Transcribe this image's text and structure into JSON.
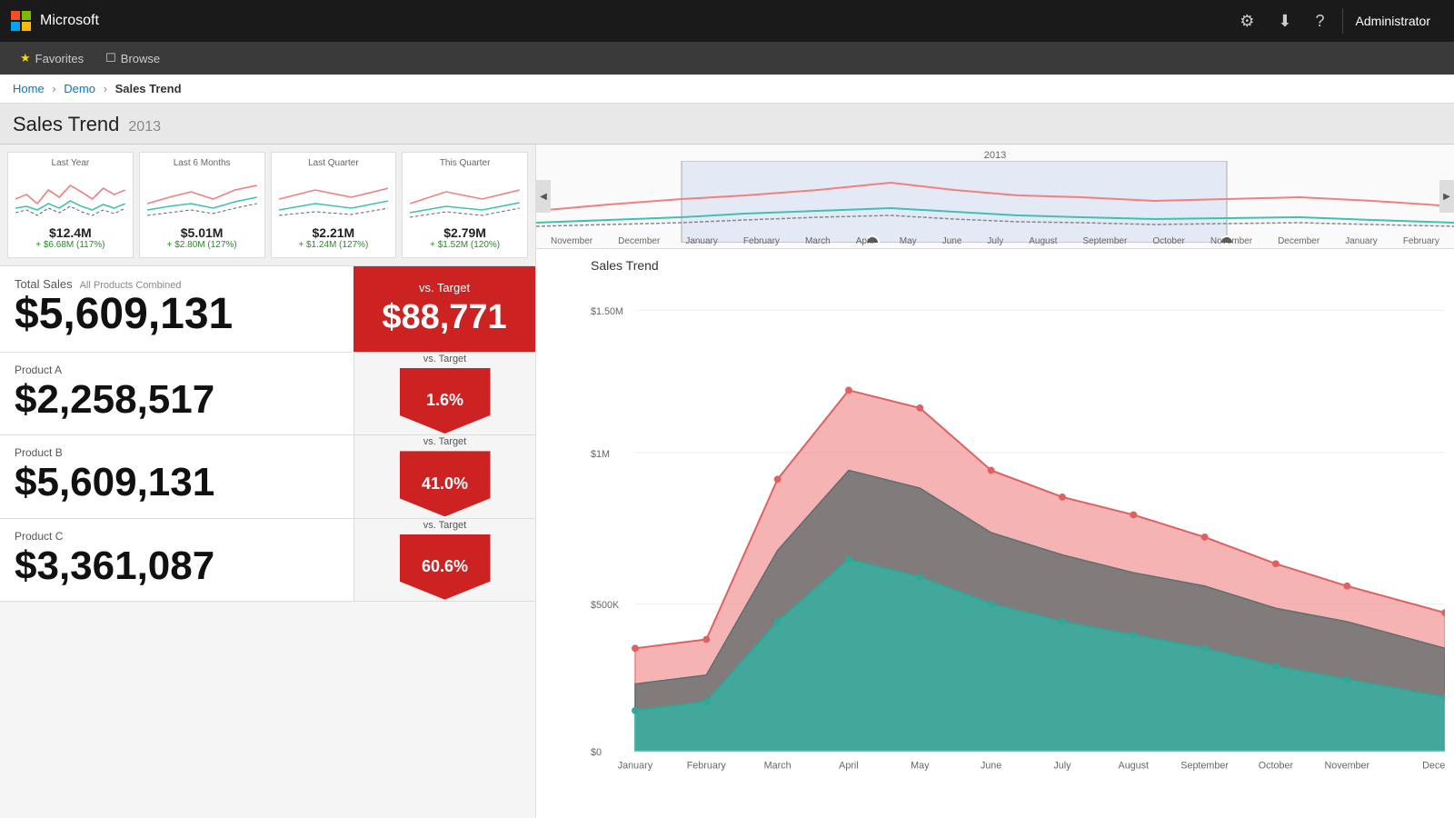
{
  "topbar": {
    "brand": "Microsoft",
    "settings_label": "⚙",
    "download_label": "⬇",
    "help_label": "?",
    "user": "Administrator"
  },
  "secondbar": {
    "favorites_label": "Favorites",
    "browse_label": "Browse"
  },
  "breadcrumb": {
    "home": "Home",
    "demo": "Demo",
    "current": "Sales Trend"
  },
  "page": {
    "title": "Sales Trend",
    "year": "2013"
  },
  "thumbnails": [
    {
      "title": "Last Year",
      "value": "$12.4M",
      "delta": "+ $6.68M (117%)"
    },
    {
      "title": "Last 6 Months",
      "value": "$5.01M",
      "delta": "+ $2.80M (127%)"
    },
    {
      "title": "Last Quarter",
      "value": "$2.21M",
      "delta": "+ $1.24M (127%)"
    },
    {
      "title": "This Quarter",
      "value": "$2.79M",
      "delta": "+ $1.52M (120%)"
    }
  ],
  "metrics": {
    "total_sales": {
      "label": "Total Sales",
      "sublabel": "All Products Combined",
      "value": "$5,609,131",
      "target_label": "vs. Target",
      "target_value": "$88,771"
    },
    "product_a": {
      "label": "Product A",
      "value": "$2,258,517",
      "target_label": "vs. Target",
      "target_pct": "1.6%"
    },
    "product_b": {
      "label": "Product B",
      "value": "$5,609,131",
      "target_label": "vs. Target",
      "target_pct": "41.0%"
    },
    "product_c": {
      "label": "Product C",
      "value": "$3,361,087",
      "target_label": "vs. Target",
      "target_pct": "60.6%"
    }
  },
  "timeline": {
    "title": "2013",
    "months": [
      "November",
      "December",
      "January",
      "February",
      "March",
      "April",
      "May",
      "June",
      "July",
      "August",
      "September",
      "October",
      "November",
      "December",
      "January",
      "February"
    ]
  },
  "chart": {
    "title": "Sales Trend",
    "y_labels": [
      "$1.50M",
      "$1M",
      "$500K",
      "$0"
    ],
    "x_labels": [
      "January",
      "February",
      "March",
      "April",
      "May",
      "June",
      "July",
      "August",
      "September",
      "October",
      "November",
      "December"
    ],
    "colors": {
      "product_a": "#f08080",
      "product_b": "#5f7a7a",
      "product_c": "#40c0b0"
    }
  }
}
